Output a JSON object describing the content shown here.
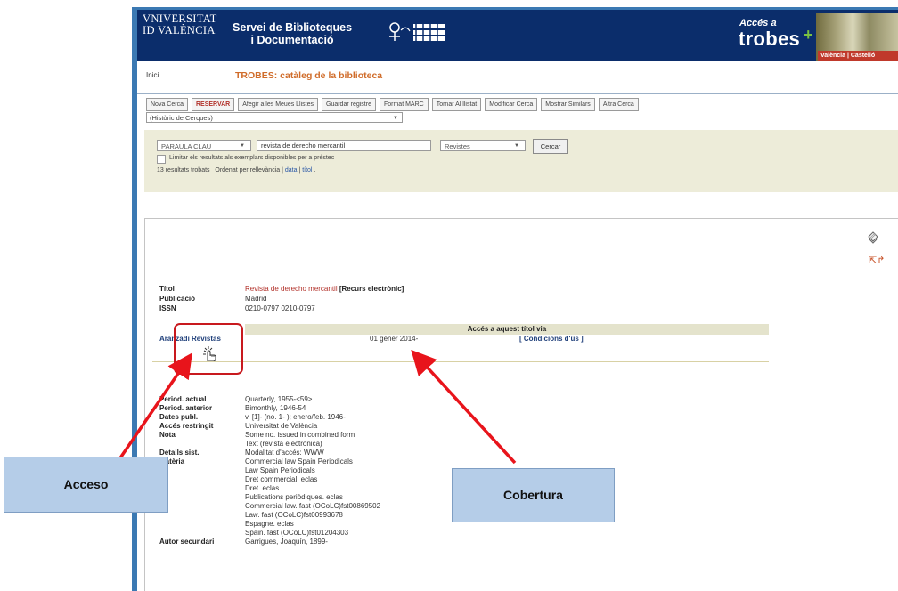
{
  "banner": {
    "university_line1": "VNIVERSITAT",
    "university_line2": "ID VALÈNCIA",
    "service_line1": "Servei de Biblioteques",
    "service_line2": "i Documentació",
    "acces_label": "Accés a",
    "trobes_label": "trobes",
    "trobes_plus": "+",
    "campus_label": "València | Castelló"
  },
  "nav": {
    "home_label": "Inici",
    "catalog_title": "TROBES: catàleg de la biblioteca"
  },
  "toolbar": {
    "buttons": [
      "Nova Cerca",
      "RESERVAR",
      "Afegir a les Meues Llistes",
      "Guardar registre",
      "Format MARC",
      "Tornar Al llistat",
      "Modificar Cerca",
      "Mostrar Similars",
      "Altra Cerca"
    ],
    "history_label": "(Històric de Cerques)"
  },
  "search": {
    "index_value": "PARAULA CLAU",
    "query_value": "revista de derecho mercantil",
    "material_value": "Revistes",
    "button_label": "Cercar",
    "limit_label": "Limitar els resultats als exemplars disponibles per a préstec",
    "results_count": "13 resultats trobats",
    "sort_prefix": "Ordenat per rellevància",
    "sort_date": "data",
    "sort_title": "títol"
  },
  "record": {
    "title_label": "Títol",
    "title_value": "Revista de derecho mercantil",
    "title_suffix": "[Recurs electrònic]",
    "pub_label": "Publicació",
    "pub_value": "Madrid",
    "issn_label": "ISSN",
    "issn_value": "0210-0797 0210-0797",
    "access_header": "Accés a aquest títol via",
    "provider": "Aranzadi Revistas",
    "coverage": "01 gener 2014-",
    "conditions": "[ Condicions d'ús ]",
    "details": [
      {
        "label": "Period. actual",
        "value": "Quarterly, 1955-<59>"
      },
      {
        "label": "Period. anterior",
        "value": "Bimonthly, 1946-54"
      },
      {
        "label": "Dates publ.",
        "value": "v. [1]- (no. 1- ); enero/feb. 1946-"
      },
      {
        "label": "Accés restringit",
        "value": "Universitat de València"
      },
      {
        "label": "Nota",
        "value": "Some no. issued in combined form"
      },
      {
        "label": "",
        "value": "Text (revista electrònica)"
      },
      {
        "label": "Detalls sist.",
        "value": "Modalitat d'accés: WWW"
      },
      {
        "label": "Matèria",
        "value": "Commercial law Spain Periodicals"
      },
      {
        "label": "",
        "value": "Law Spain Periodicals"
      },
      {
        "label": "",
        "value": "Dret commercial. eclas"
      },
      {
        "label": "",
        "value": "Dret. eclas"
      },
      {
        "label": "",
        "value": "Publications periòdiques. eclas"
      },
      {
        "label": "",
        "value": "Commercial law. fast (OCoLC)fst00869502"
      },
      {
        "label": "",
        "value": "Law. fast (OCoLC)fst00993678"
      },
      {
        "label": "",
        "value": "Espagne. eclas"
      },
      {
        "label": "",
        "value": "Spain. fast (OCoLC)fst01204303"
      },
      {
        "label": "Autor secundari",
        "value": "Garrigues, Joaquín, 1899-"
      }
    ]
  },
  "callouts": {
    "access": "Acceso",
    "coverage": "Cobertura"
  },
  "colors": {
    "banner": "#0b2d6b",
    "accent_red": "#c8191e",
    "callout_fill": "#b5cde8",
    "link_blue": "#1f3f7a",
    "title_orange": "#d06c2a"
  }
}
